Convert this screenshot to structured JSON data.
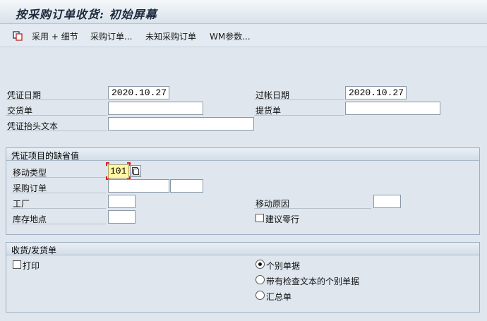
{
  "window": {
    "title": "按采购订单收货: 初始屏幕"
  },
  "toolbar": {
    "item1": "采用 + 细节",
    "item2": "采购订单...",
    "item3": "未知采购订单",
    "item4": "WM参数..."
  },
  "header_fields": {
    "doc_date_label": "凭证日期",
    "doc_date_value": "2020.10.27",
    "post_date_label": "过帐日期",
    "post_date_value": "2020.10.27",
    "delivery_note_label": "交货单",
    "delivery_note_value": "",
    "bill_of_lading_label": "提货单",
    "bill_of_lading_value": "",
    "header_text_label": "凭证抬头文本",
    "header_text_value": ""
  },
  "defaults_group": {
    "title": "凭证项目的缺省值",
    "movement_type_label": "移动类型",
    "movement_type_value": "101",
    "po_label": "采购订单",
    "po_value": "",
    "po_item_value": "",
    "plant_label": "工厂",
    "plant_value": "",
    "reason_label": "移动原因",
    "reason_value": "",
    "sloc_label": "库存地点",
    "sloc_value": "",
    "suggest_zero_label": "建议零行"
  },
  "slip_group": {
    "title": "收货/发货单",
    "print_label": "打印",
    "opt_individual": "个别单据",
    "opt_individual_check": "带有检查文本的个别单据",
    "opt_collective": "汇总单"
  },
  "colors": {
    "accent": "#d02020",
    "highlight": "#fef7a8",
    "background": "#dfe6ee"
  }
}
